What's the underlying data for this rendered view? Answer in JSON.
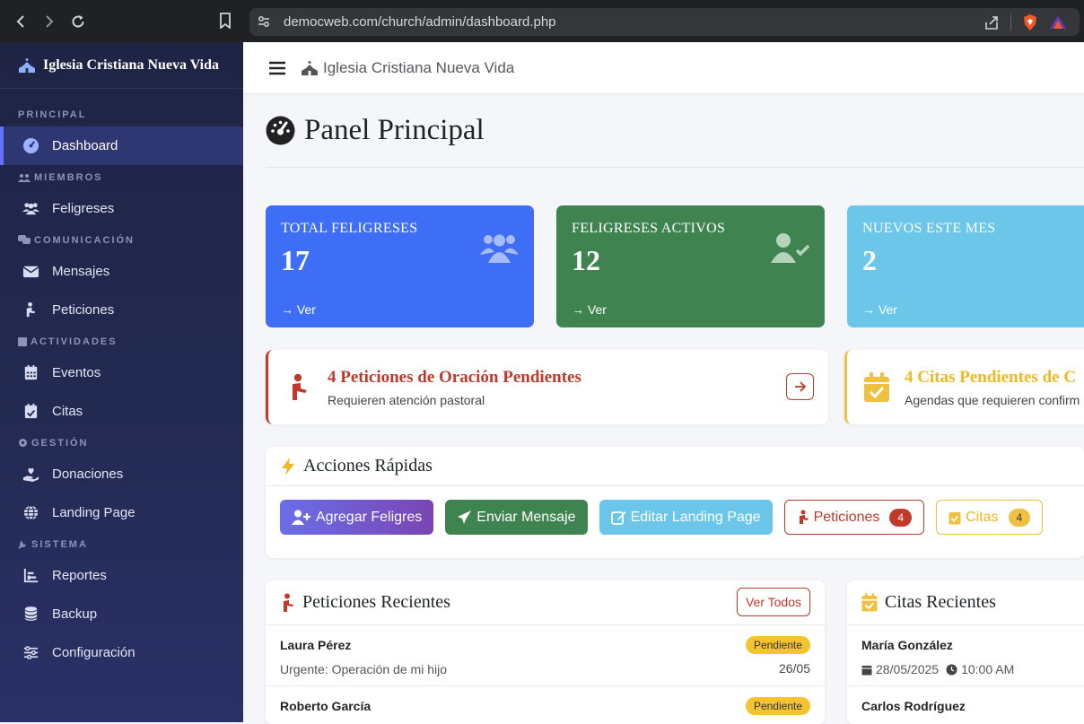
{
  "browser": {
    "url": "democweb.com/church/admin/dashboard.php"
  },
  "sidebar": {
    "brand": "Iglesia Cristiana Nueva Vida",
    "sections": {
      "principal": "PRINCIPAL",
      "miembros": "MIEMBROS",
      "comunicacion": "COMUNICACIÓN",
      "actividades": "ACTIVIDADES",
      "gestion": "GESTIÓN",
      "sistema": "SISTEMA"
    },
    "items": {
      "dashboard": "Dashboard",
      "feligreses": "Feligreses",
      "mensajes": "Mensajes",
      "peticiones": "Peticiones",
      "eventos": "Eventos",
      "citas": "Citas",
      "donaciones": "Donaciones",
      "landing": "Landing Page",
      "reportes": "Reportes",
      "backup": "Backup",
      "configuracion": "Configuración"
    }
  },
  "topbar": {
    "title": "Iglesia Cristiana Nueva Vida"
  },
  "page": {
    "title": "Panel Principal"
  },
  "stats": [
    {
      "label": "TOTAL FELIGRESES",
      "value": "17",
      "link": "→ Ver",
      "color": "#3d6ef5"
    },
    {
      "label": "FELIGRESES ACTIVOS",
      "value": "12",
      "link": "→ Ver",
      "color": "#3f8450"
    },
    {
      "label": "NUEVOS ESTE MES",
      "value": "2",
      "link": "→ Ver",
      "color": "#6cc6ea"
    }
  ],
  "alerts": {
    "peticiones": {
      "title": "4 Peticiones de Oración Pendientes",
      "subtitle": "Requieren atención pastoral"
    },
    "citas": {
      "title": "4 Citas Pendientes de C",
      "subtitle": "Agendas que requieren confirm"
    }
  },
  "quick_actions": {
    "title": "Acciones Rápidas",
    "agregar": "Agregar Feligres",
    "enviar": "Enviar Mensaje",
    "editar": "Editar Landing Page",
    "peticiones": "Peticiones",
    "peticiones_count": "4",
    "citas": "Citas",
    "citas_count": "4"
  },
  "peticiones_recientes": {
    "title": "Peticiones Recientes",
    "ver_todos": "Ver Todos",
    "rows": [
      {
        "name": "Laura Pérez",
        "status": "Pendiente",
        "desc": "Urgente: Operación de mi hijo",
        "date": "26/05"
      },
      {
        "name": "Roberto García",
        "status": "Pendiente"
      }
    ]
  },
  "citas_recientes": {
    "title": "Citas Recientes",
    "rows": [
      {
        "name": "María González",
        "date": "28/05/2025",
        "time": "10:00 AM"
      },
      {
        "name": "Carlos Rodríguez"
      }
    ]
  }
}
